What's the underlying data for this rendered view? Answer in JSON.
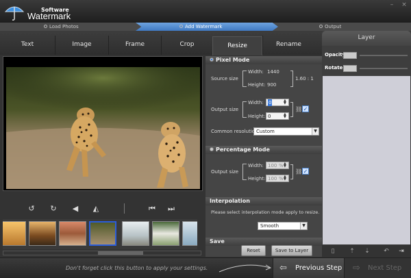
{
  "app": {
    "title_small": "Software",
    "title_main": "Watermark"
  },
  "window_controls": {
    "minimize": "–",
    "close": "×"
  },
  "steps": [
    {
      "label": "Load Photos"
    },
    {
      "label": "Add Watermark"
    },
    {
      "label": "Output"
    }
  ],
  "tabs": [
    {
      "label": "Text"
    },
    {
      "label": "Image"
    },
    {
      "label": "Frame"
    },
    {
      "label": "Crop"
    },
    {
      "label": "Resize"
    },
    {
      "label": "Rename"
    }
  ],
  "active_tab": "Resize",
  "pixel_mode": {
    "title": "Pixel Mode",
    "source_size_label": "Source size",
    "source_width_label": "Width:",
    "source_width": "1440",
    "source_height_label": "Height:",
    "source_height": "900",
    "ratio": "1.60 : 1",
    "output_size_label": "Output size",
    "output_width_label": "Width:",
    "output_width": "0",
    "output_height_label": "Height:",
    "output_height": "0",
    "keep_ratio_checked": "✓",
    "common_resolution_label": "Common resolution:",
    "common_resolution_value": "Custom"
  },
  "percentage_mode": {
    "title": "Percentage Mode",
    "output_size_label": "Output size",
    "width_label": "Width:",
    "width_value": "100",
    "height_label": "Height:",
    "height_value": "100",
    "unit": "%",
    "keep_ratio_checked": "✓"
  },
  "interpolation": {
    "title": "Interpolation",
    "description": "Please select interpolation mode apply to resize.",
    "mode": "Smooth"
  },
  "save": {
    "title": "Save",
    "reset_label": "Reset",
    "save_to_layer_label": "Save to Layer"
  },
  "layer_panel": {
    "title": "Layer",
    "opacity_label": "Opacity",
    "rotate_label": "Rotate"
  },
  "footer": {
    "hint": "Don't forget click this button to apply your settings.",
    "previous_label": "Previous Step",
    "next_label": "Next Step"
  },
  "colors": {
    "accent": "#3f79c2",
    "thumb_selected": "#2b5ddb"
  }
}
